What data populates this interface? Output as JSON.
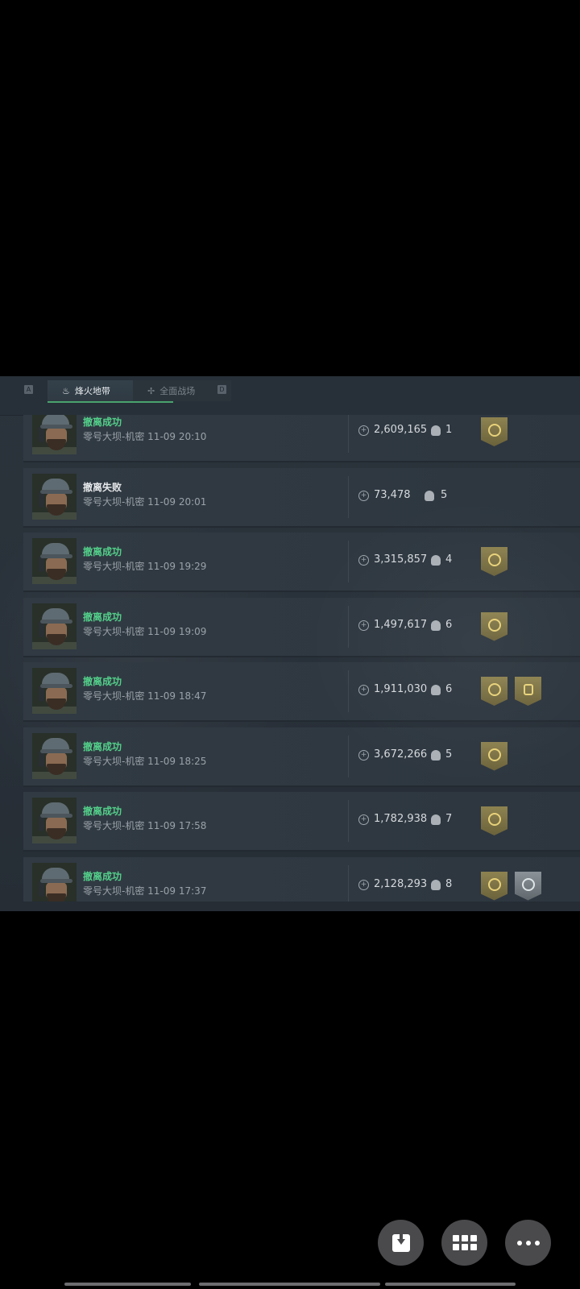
{
  "tabs": {
    "left_key": "A",
    "right_key": "D",
    "active_label": "烽火地带",
    "inactive_label": "全面战场"
  },
  "records": [
    {
      "status": "撤离成功",
      "status_type": "ok",
      "map": "零号大坝-机密",
      "time": "11-09 20:10",
      "value": "2,609,165",
      "kills": "1",
      "badges": [
        "gold"
      ]
    },
    {
      "status": "撤离失败",
      "status_type": "fail",
      "map": "零号大坝-机密",
      "time": "11-09 20:01",
      "value": "73,478",
      "kills": "5",
      "badges": []
    },
    {
      "status": "撤离成功",
      "status_type": "ok",
      "map": "零号大坝-机密",
      "time": "11-09 19:29",
      "value": "3,315,857",
      "kills": "4",
      "badges": [
        "gold"
      ]
    },
    {
      "status": "撤离成功",
      "status_type": "ok",
      "map": "零号大坝-机密",
      "time": "11-09 19:09",
      "value": "1,497,617",
      "kills": "6",
      "badges": [
        "gold"
      ]
    },
    {
      "status": "撤离成功",
      "status_type": "ok",
      "map": "零号大坝-机密",
      "time": "11-09 18:47",
      "value": "1,911,030",
      "kills": "6",
      "badges": [
        "gold",
        "gold-helmet"
      ]
    },
    {
      "status": "撤离成功",
      "status_type": "ok",
      "map": "零号大坝-机密",
      "time": "11-09 18:25",
      "value": "3,672,266",
      "kills": "5",
      "badges": [
        "gold"
      ]
    },
    {
      "status": "撤离成功",
      "status_type": "ok",
      "map": "零号大坝-机密",
      "time": "11-09 17:58",
      "value": "1,782,938",
      "kills": "7",
      "badges": [
        "gold"
      ]
    },
    {
      "status": "撤离成功",
      "status_type": "ok",
      "map": "零号大坝-机密",
      "time": "11-09 17:37",
      "value": "2,128,293",
      "kills": "8",
      "badges": [
        "gold",
        "silver"
      ]
    }
  ],
  "fabs": {
    "download_icon": "download-icon",
    "apps_icon": "apps-grid-icon",
    "more_icon": "more-icon"
  },
  "colors": {
    "success": "#53d08a",
    "fail": "#e7eaec",
    "badge_gold": "#8d8250",
    "tab_underline": "#49a36d"
  }
}
